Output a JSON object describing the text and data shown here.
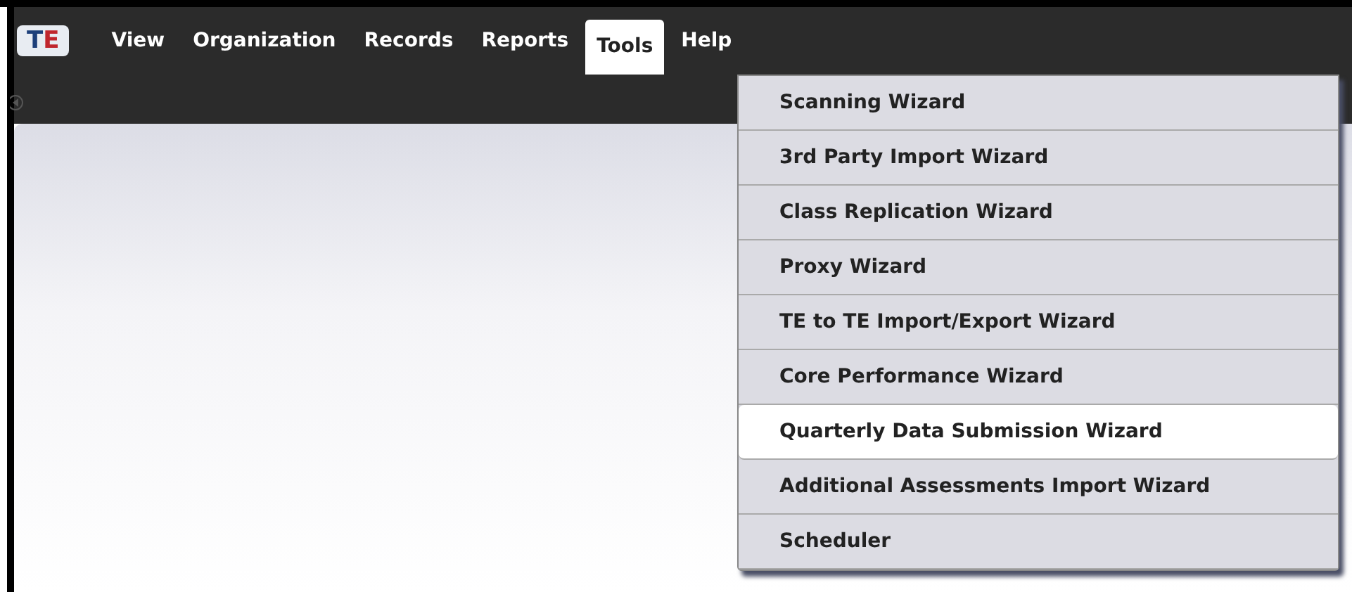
{
  "logo": "TE",
  "menu": [
    {
      "label": "View",
      "selected": false
    },
    {
      "label": "Organization",
      "selected": false
    },
    {
      "label": "Records",
      "selected": false
    },
    {
      "label": "Reports",
      "selected": false
    },
    {
      "label": "Tools",
      "selected": true
    },
    {
      "label": "Help",
      "selected": false
    }
  ],
  "dropdown": [
    {
      "label": "Scanning Wizard",
      "selected": false
    },
    {
      "label": "3rd Party Import Wizard",
      "selected": false
    },
    {
      "label": "Class Replication Wizard",
      "selected": false
    },
    {
      "label": "Proxy Wizard",
      "selected": false
    },
    {
      "label": "TE to TE Import/Export Wizard",
      "selected": false
    },
    {
      "label": "Core Performance Wizard",
      "selected": false
    },
    {
      "label": "Quarterly Data Submission Wizard",
      "selected": true
    },
    {
      "label": "Additional Assessments Import Wizard",
      "selected": false
    },
    {
      "label": "Scheduler",
      "selected": false
    }
  ]
}
